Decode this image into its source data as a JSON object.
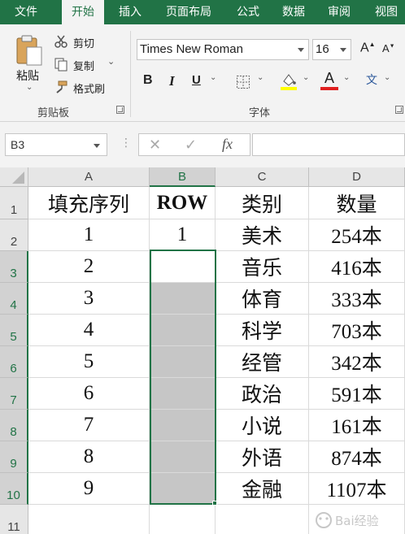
{
  "ribbon": {
    "tabs": [
      "文件",
      "开始",
      "插入",
      "页面布局",
      "公式",
      "数据",
      "审阅",
      "视图"
    ],
    "active_tab": "开始",
    "clipboard": {
      "paste_label": "粘贴",
      "cut_label": "剪切",
      "copy_label": "复制",
      "format_painter_label": "格式刷",
      "group_label": "剪贴板"
    },
    "font": {
      "font_name": "Times New Roman",
      "font_size": "16",
      "bold_glyph": "B",
      "italic_glyph": "I",
      "underline_glyph": "U",
      "grow_glyph": "A",
      "shrink_glyph": "A",
      "font_color_glyph": "A",
      "wen_glyph": "文",
      "group_label": "字体"
    },
    "colors": {
      "brand": "#217346",
      "highlight": "#ffff00",
      "font_color": "#e02020"
    }
  },
  "formula_bar": {
    "name_box": "B3",
    "fx_label": "fx",
    "formula": ""
  },
  "sheet": {
    "columns": [
      "A",
      "B",
      "C",
      "D"
    ],
    "selected_column": "B",
    "rows": [
      "1",
      "2",
      "3",
      "4",
      "5",
      "6",
      "7",
      "8",
      "9",
      "10",
      "11"
    ],
    "selected_rows": [
      "3",
      "4",
      "5",
      "6",
      "7",
      "8",
      "9",
      "10"
    ],
    "active_cell": "B3",
    "selection_range": "B3:B10",
    "cells": [
      [
        "填充序列",
        "ROW",
        "类别",
        "数量"
      ],
      [
        "1",
        "1",
        "美术",
        "254本"
      ],
      [
        "2",
        "",
        "音乐",
        "416本"
      ],
      [
        "3",
        "",
        "体育",
        "333本"
      ],
      [
        "4",
        "",
        "科学",
        "703本"
      ],
      [
        "5",
        "",
        "经管",
        "342本"
      ],
      [
        "6",
        "",
        "政治",
        "591本"
      ],
      [
        "7",
        "",
        "小说",
        "161本"
      ],
      [
        "8",
        "",
        "外语",
        "874本"
      ],
      [
        "9",
        "",
        "金融",
        "1107本"
      ],
      [
        "",
        "",
        "",
        ""
      ]
    ]
  },
  "watermark": {
    "text": "Bai经验"
  }
}
